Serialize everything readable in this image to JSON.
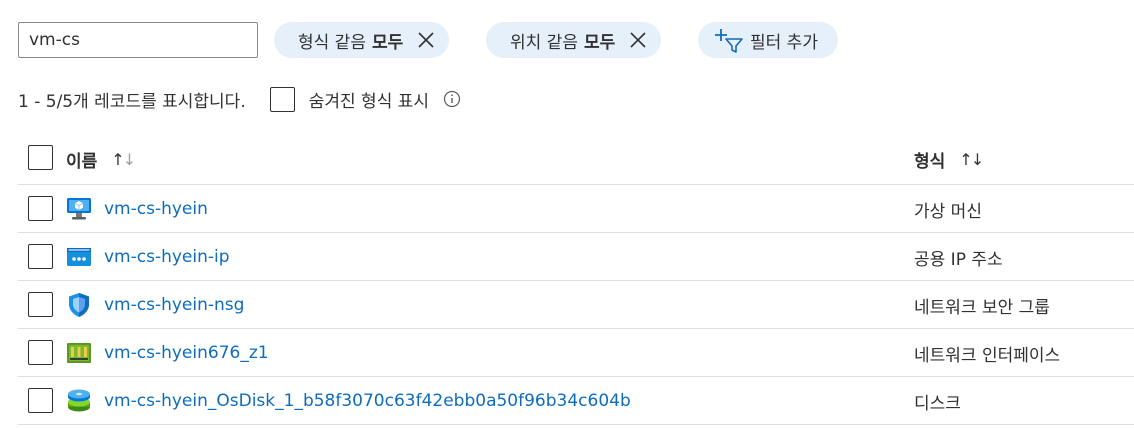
{
  "search": {
    "value": "vm-cs"
  },
  "filters": [
    {
      "label": "형식 같음",
      "value": "모두"
    },
    {
      "label": "위치 같음",
      "value": "모두"
    }
  ],
  "add_filter_label": "필터 추가",
  "record_count_text": "1 - 5/5개 레코드를 표시합니다.",
  "show_hidden_label": "숨겨진 형식 표시",
  "table": {
    "columns": {
      "name": "이름",
      "type": "형식"
    },
    "rows": [
      {
        "name": "vm-cs-hyein",
        "type": "가상 머신",
        "icon": "virtual-machine-icon"
      },
      {
        "name": "vm-cs-hyein-ip",
        "type": "공용 IP 주소",
        "icon": "public-ip-icon"
      },
      {
        "name": "vm-cs-hyein-nsg",
        "type": "네트워크 보안 그룹",
        "icon": "network-security-group-icon"
      },
      {
        "name": "vm-cs-hyein676_z1",
        "type": "네트워크 인터페이스",
        "icon": "network-interface-icon"
      },
      {
        "name": "vm-cs-hyein_OsDisk_1_b58f3070c63f42ebb0a50f96b34c604b",
        "type": "디스크",
        "icon": "disk-icon"
      }
    ]
  },
  "colors": {
    "link": "#0f6cbd",
    "pill_bg": "#e5f0fb",
    "border": "#e1dfdd"
  }
}
